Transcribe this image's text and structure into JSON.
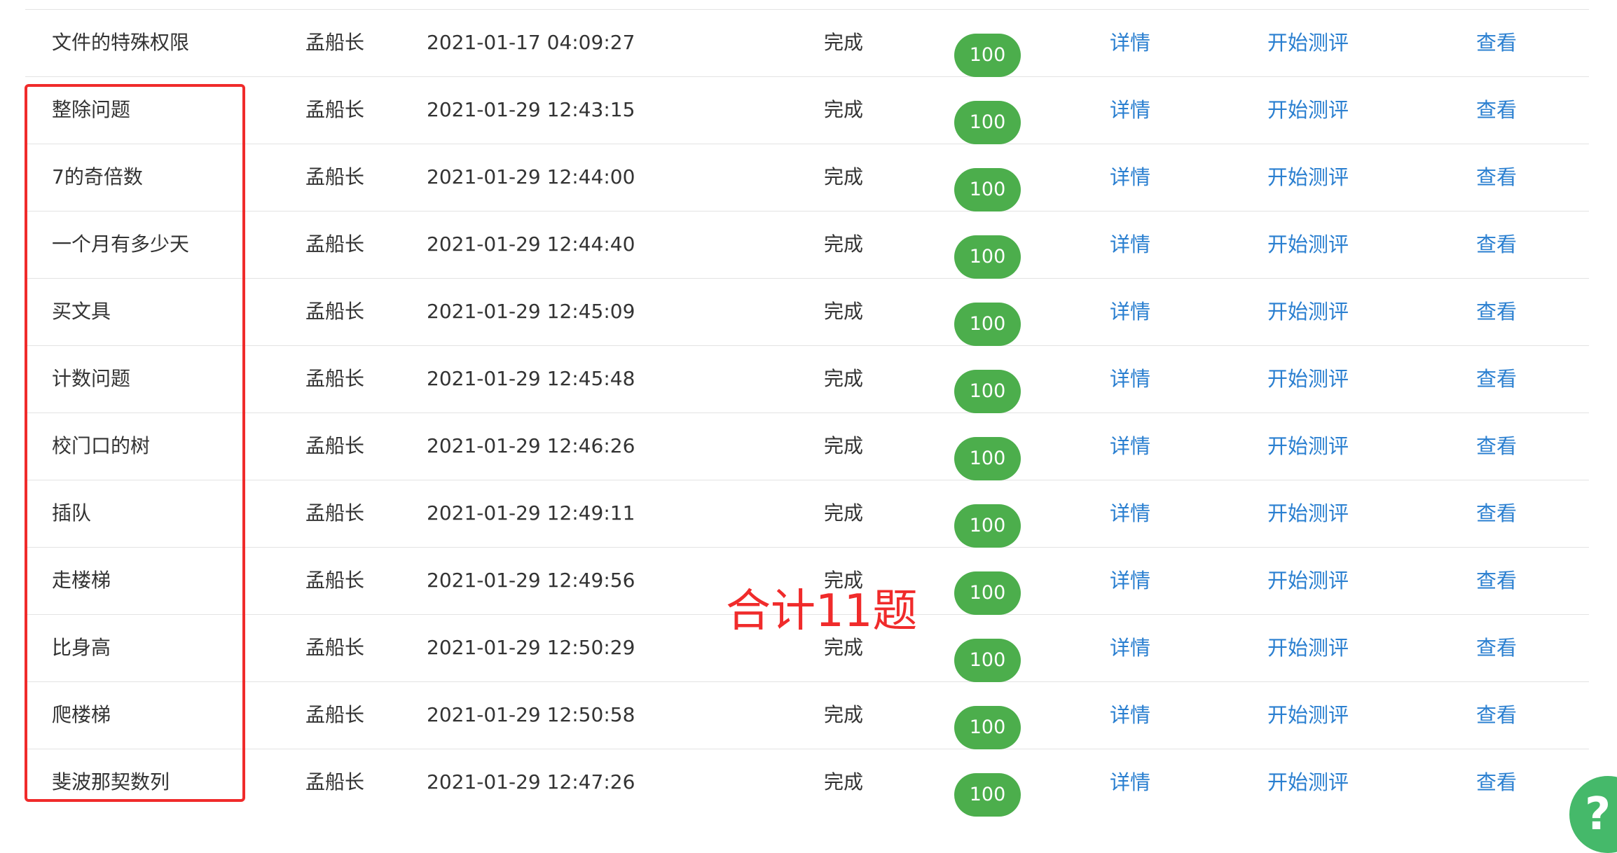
{
  "rows": [
    {
      "name": "文件的特殊权限",
      "author": "孟船长",
      "time": "2021-01-17 04:09:27",
      "status": "完成",
      "score": "100",
      "detail": "详情",
      "evaluate": "开始测评",
      "view": "查看"
    },
    {
      "name": "整除问题",
      "author": "孟船长",
      "time": "2021-01-29 12:43:15",
      "status": "完成",
      "score": "100",
      "detail": "详情",
      "evaluate": "开始测评",
      "view": "查看"
    },
    {
      "name": "7的奇倍数",
      "author": "孟船长",
      "time": "2021-01-29 12:44:00",
      "status": "完成",
      "score": "100",
      "detail": "详情",
      "evaluate": "开始测评",
      "view": "查看"
    },
    {
      "name": "一个月有多少天",
      "author": "孟船长",
      "time": "2021-01-29 12:44:40",
      "status": "完成",
      "score": "100",
      "detail": "详情",
      "evaluate": "开始测评",
      "view": "查看"
    },
    {
      "name": "买文具",
      "author": "孟船长",
      "time": "2021-01-29 12:45:09",
      "status": "完成",
      "score": "100",
      "detail": "详情",
      "evaluate": "开始测评",
      "view": "查看"
    },
    {
      "name": "计数问题",
      "author": "孟船长",
      "time": "2021-01-29 12:45:48",
      "status": "完成",
      "score": "100",
      "detail": "详情",
      "evaluate": "开始测评",
      "view": "查看"
    },
    {
      "name": "校门口的树",
      "author": "孟船长",
      "time": "2021-01-29 12:46:26",
      "status": "完成",
      "score": "100",
      "detail": "详情",
      "evaluate": "开始测评",
      "view": "查看"
    },
    {
      "name": "插队",
      "author": "孟船长",
      "time": "2021-01-29 12:49:11",
      "status": "完成",
      "score": "100",
      "detail": "详情",
      "evaluate": "开始测评",
      "view": "查看"
    },
    {
      "name": "走楼梯",
      "author": "孟船长",
      "time": "2021-01-29 12:49:56",
      "status": "完成",
      "score": "100",
      "detail": "详情",
      "evaluate": "开始测评",
      "view": "查看"
    },
    {
      "name": "比身高",
      "author": "孟船长",
      "time": "2021-01-29 12:50:29",
      "status": "完成",
      "score": "100",
      "detail": "详情",
      "evaluate": "开始测评",
      "view": "查看"
    },
    {
      "name": "爬楼梯",
      "author": "孟船长",
      "time": "2021-01-29 12:50:58",
      "status": "完成",
      "score": "100",
      "detail": "详情",
      "evaluate": "开始测评",
      "view": "查看"
    },
    {
      "name": "斐波那契数列",
      "author": "孟船长",
      "time": "2021-01-29 12:47:26",
      "status": "完成",
      "score": "100",
      "detail": "详情",
      "evaluate": "开始测评",
      "view": "查看"
    }
  ],
  "annotation": {
    "text": "合计11题",
    "color": "#f02b2b"
  },
  "help_button": {
    "label": "?",
    "icon": "help-icon"
  },
  "colors": {
    "link": "#2a7fd0",
    "score_badge": "#4cae4c",
    "highlight_box": "#f02b2b"
  }
}
